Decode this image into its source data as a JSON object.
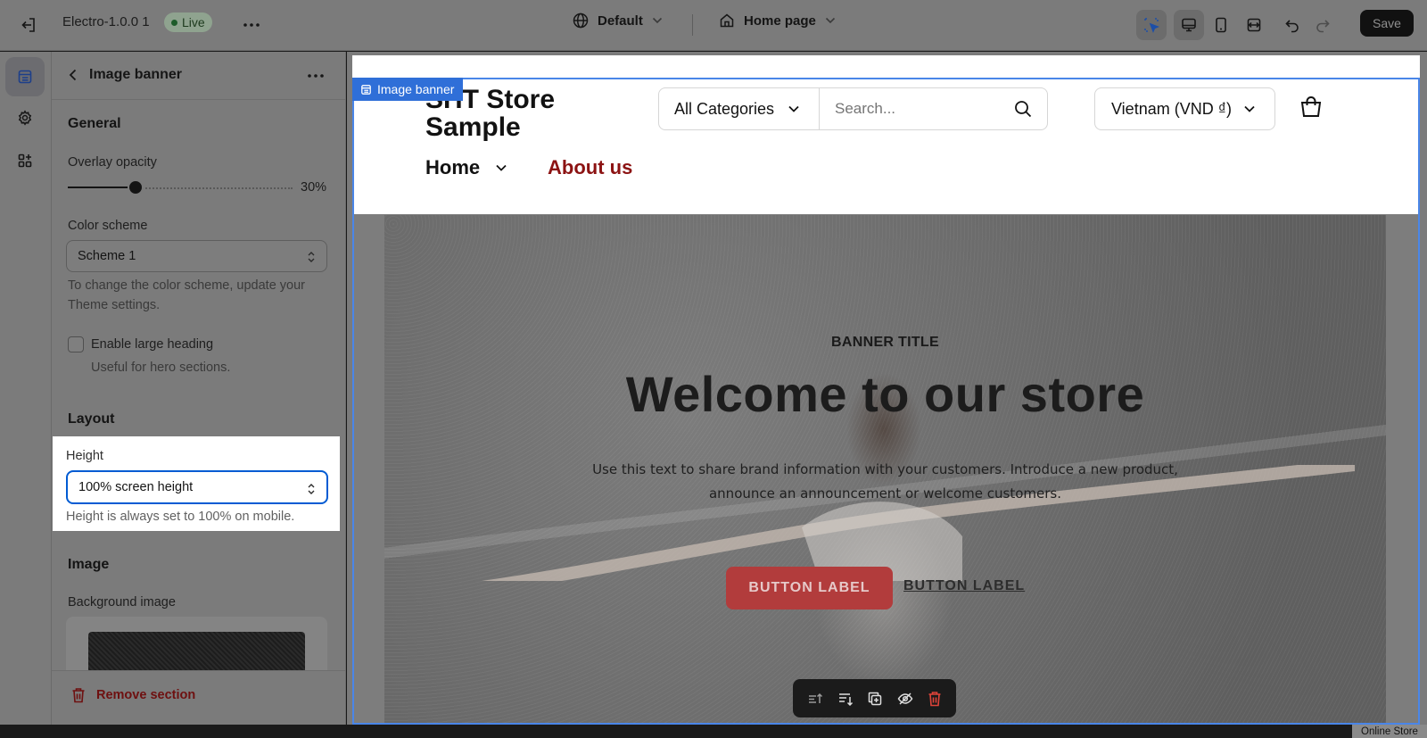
{
  "topbar": {
    "app_name": "Electro-1.0.0 1",
    "status": "Live",
    "theme": "Default",
    "page": "Home page",
    "save_label": "Save"
  },
  "panel": {
    "title": "Image banner",
    "general_title": "General",
    "overlay_label": "Overlay opacity",
    "overlay_value": 30,
    "overlay_display": "30%",
    "color_scheme_label": "Color scheme",
    "color_scheme_value": "Scheme 1",
    "color_scheme_help_1": "To change the color scheme, update your",
    "color_scheme_help_2": "Theme settings.",
    "large_heading_label": "Enable large heading",
    "large_heading_help": "Useful for hero sections.",
    "layout_title": "Layout",
    "height_label": "Height",
    "height_value": "100% screen height",
    "height_help": "Height is always set to 100% on mobile.",
    "image_title": "Image",
    "bg_image_label": "Background image",
    "remove_label": "Remove section"
  },
  "store": {
    "logo": "SHT Store Sample",
    "category_select": "All Categories",
    "search_placeholder": "Search...",
    "currency": "Vietnam (VND ₫)",
    "nav": [
      "Home",
      "About us"
    ],
    "section_tag": "Image banner",
    "banner": {
      "kicker": "BANNER TITLE",
      "title": "Welcome to our store",
      "text": "Use this text to share brand information with your customers. Introduce a new product, announce an announcement or welcome customers.",
      "button_1": "BUTTON LABEL",
      "button_2": "BUTTON LABEL"
    }
  },
  "footer_tag": "Online Store",
  "colors": {
    "accent_blue": "#005bd3",
    "about_link": "#8c1313",
    "primary_button": "#b23c3c",
    "remove": "#6e1010"
  }
}
